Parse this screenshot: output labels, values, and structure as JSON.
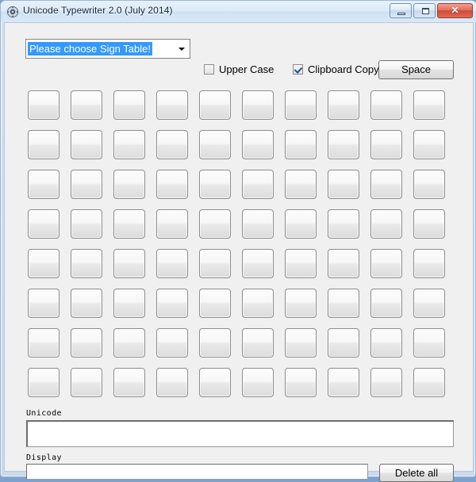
{
  "window": {
    "title": "Unicode Typewriter 2.0 (July 2014)",
    "app_icon": "gear-icon",
    "controls": {
      "minimize": "minimize-icon",
      "maximize": "maximize-icon",
      "close_label": "✕"
    },
    "frame_color": "#9db8d6",
    "client_bg": "#f0f0f0"
  },
  "toolbar": {
    "sign_table_select": {
      "selected_value": "Please choose Sign Table!",
      "highlight_color": "#3399ff",
      "arrow_icon": "chevron-down-icon"
    },
    "upper_case": {
      "label": "Upper Case",
      "checked": false
    },
    "clipboard_copy": {
      "label": "Clipboard Copy",
      "checked": true
    },
    "space_button": {
      "label": "Space"
    }
  },
  "key_grid": {
    "rows": 8,
    "columns": 10,
    "total_keys": 80,
    "keys": [
      "",
      "",
      "",
      "",
      "",
      "",
      "",
      "",
      "",
      "",
      "",
      "",
      "",
      "",
      "",
      "",
      "",
      "",
      "",
      "",
      "",
      "",
      "",
      "",
      "",
      "",
      "",
      "",
      "",
      "",
      "",
      "",
      "",
      "",
      "",
      "",
      "",
      "",
      "",
      "",
      "",
      "",
      "",
      "",
      "",
      "",
      "",
      "",
      "",
      "",
      "",
      "",
      "",
      "",
      "",
      "",
      "",
      "",
      "",
      "",
      "",
      "",
      "",
      "",
      "",
      "",
      "",
      "",
      "",
      "",
      "",
      "",
      "",
      "",
      "",
      "",
      "",
      "",
      "",
      ""
    ]
  },
  "output": {
    "unicode": {
      "label": "Unicode",
      "value": ""
    },
    "display": {
      "label": "Display",
      "value": ""
    },
    "delete_all_button": {
      "label": "Delete all"
    }
  }
}
